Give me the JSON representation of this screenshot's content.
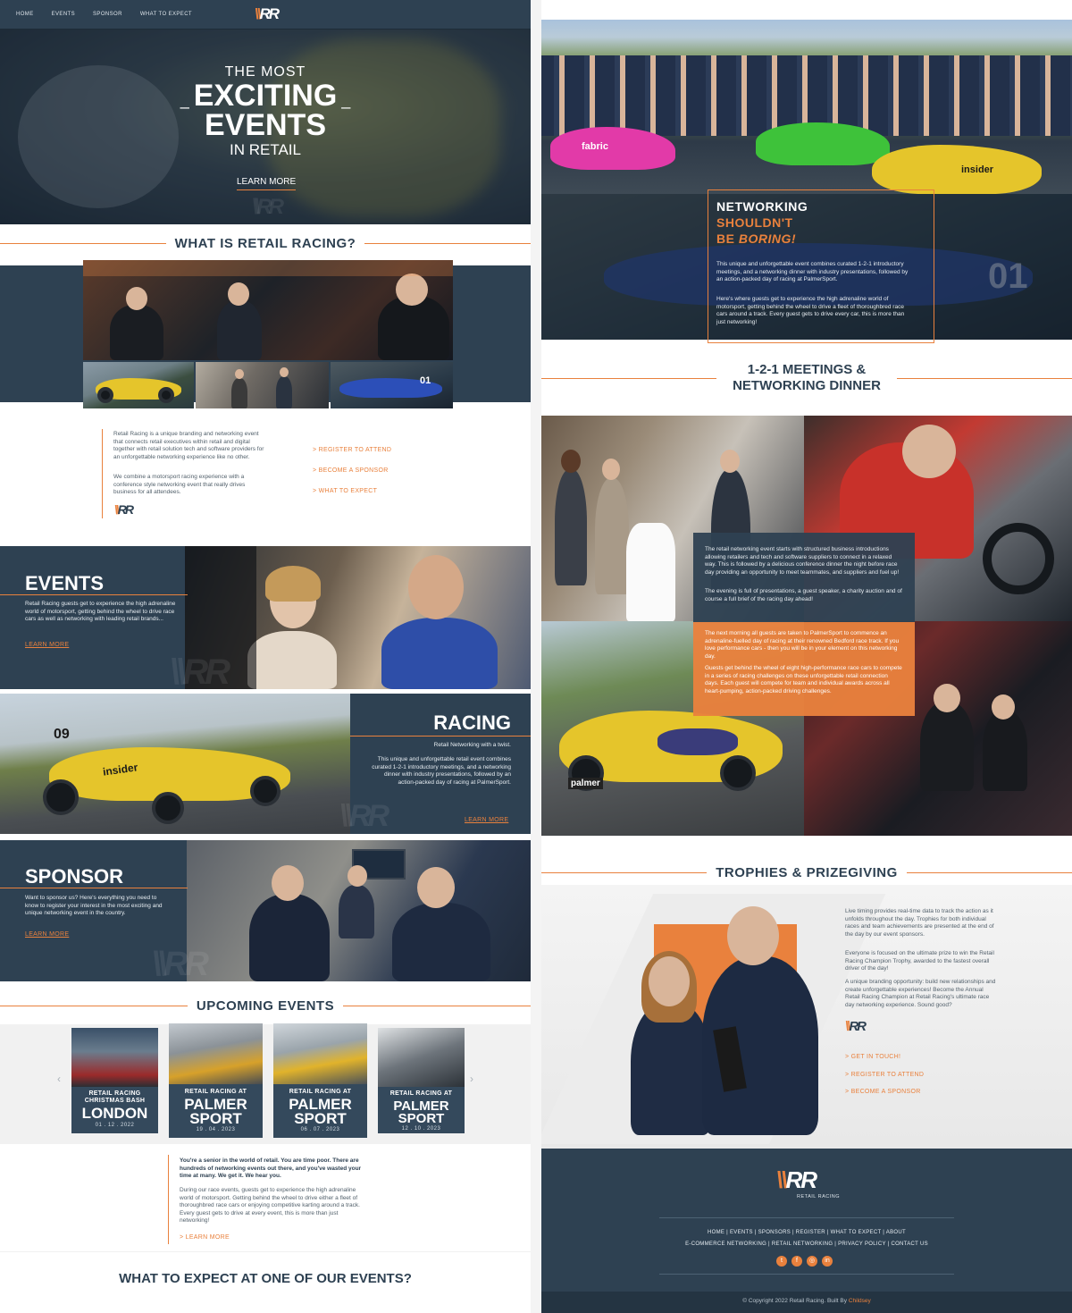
{
  "nav": {
    "items": [
      "HOME",
      "EVENTS",
      "SPONSOR",
      "WHAT TO EXPECT"
    ]
  },
  "hero": {
    "line1": "THE MOST",
    "line2": "EXCITING",
    "line3": "EVENTS",
    "line4": "IN RETAIL",
    "cta": "LEARN MORE"
  },
  "what_is": {
    "heading": "WHAT IS RETAIL RACING?",
    "para1": "Retail Racing is a unique branding and networking event that connects retail executives within retail and digital together with retail solution tech and software providers for an unforgettable networking experience like no other.",
    "para2": "We combine a motorsport racing experience with a conference style networking event that really drives business for all attendees.",
    "links": [
      "> REGISTER TO ATTEND",
      "> BECOME A SPONSOR",
      "> WHAT TO EXPECT"
    ]
  },
  "events": {
    "title": "EVENTS",
    "text": "Retail Racing guests get to experience the high adrenaline world of motorsport, getting behind the wheel to drive race cars as well as networking with leading retail brands...",
    "cta": "LEARN MORE"
  },
  "racing": {
    "title": "RACING",
    "subtitle": "Retail Networking with a twist.",
    "text": "This unique and unforgettable retail event combines curated 1-2-1 introductory meetings, and a networking dinner with industry presentations, followed by an action-packed day of racing at PalmerSport.",
    "cta": "LEARN MORE"
  },
  "sponsor": {
    "title": "SPONSOR",
    "text": "Want to sponsor us? Here's everything you need to know to register your interest in the most exciting and unique networking event in the country.",
    "cta": "LEARN MORE"
  },
  "upcoming": {
    "heading": "UPCOMING EVENTS",
    "cards": [
      {
        "top": "RETAIL RACING",
        "top2": "CHRISTMAS BASH",
        "city": "LONDON",
        "date": "01 . 12 . 2022"
      },
      {
        "top": "RETAIL RACING AT",
        "city": "PALMER",
        "city2": "SPORT",
        "date": "19 . 04 . 2023"
      },
      {
        "top": "RETAIL RACING AT",
        "city": "PALMER",
        "city2": "SPORT",
        "date": "06 . 07 . 2023"
      },
      {
        "top": "RETAIL RACING AT",
        "city": "PALMER",
        "city2": "SPORT",
        "date": "12 . 10 . 2023"
      }
    ],
    "intro": "You're a senior in the world of retail. You are time poor. There are hundreds of networking events out there, and you've wasted your time at many. We get it. We hear you.",
    "body": "During our race events, guests get to experience the high adrenaline world of motorsport. Getting behind the wheel to drive either a fleet of thoroughbred race cars or enjoying competitive karting around a track. Every guest gets to drive at every event, this is more than just networking!",
    "cta": "> LEARN MORE"
  },
  "expect": {
    "heading": "WHAT TO EXPECT AT ONE OF OUR EVENTS?"
  },
  "networking": {
    "l1": "NETWORKING",
    "l2": "SHOULDN'T",
    "l3a": "BE ",
    "l3b": "BORING!",
    "p1": "This unique and unforgettable event combines curated 1-2-1 introductory meetings, and a networking dinner with industry presentations, followed by an action-packed day of racing at PalmerSport.",
    "p2": "Here's where guests get to experience the high adrenaline world of motorsport, getting behind the wheel to drive a fleet of thoroughbred race cars around a track. Every guest gets to drive every car, this is more than just networking!"
  },
  "meetings": {
    "heading1": "1-2-1 MEETINGS &",
    "heading2": "NETWORKING DINNER",
    "box1_p1": "The retail networking event starts with structured business introductions allowing retailers and tech and software suppliers to connect in a relaxed way. This is followed by a delicious conference dinner the night before race day providing an opportunity to meet teammates, and suppliers and fuel up!",
    "box1_p2": "The evening is full of presentations, a guest speaker, a charity auction and of course a full brief of the racing day ahead!",
    "box2_p1": "The next morning all guests are taken to PalmerSport to commence an adrenaline-fuelled day of racing at their renowned Bedford race track. If you love performance cars - then you will be in your element on this networking day.",
    "box2_p2": "Guests get behind the wheel of eight high-performance race cars to compete in a series of racing challenges on these unforgettable retail connection days. Each guest will compete for team and individual awards across all heart-pumping, action-packed driving challenges."
  },
  "trophies": {
    "heading": "TROPHIES & PRIZEGIVING",
    "p1": "Live timing provides real-time data to track the action as it unfolds throughout the day. Trophies for both individual races and team achievements are presented at the end of the day by our event sponsors.",
    "p2": "Everyone is focused on the ultimate prize to win the Retail Racing Champion Trophy, awarded to the fastest overall driver of the day!",
    "p3": "A unique branding opportunity: build new relationships and create unforgettable experiences! Become the Annual Retail Racing Champion at Retail Racing's ultimate race day networking experience. Sound good?",
    "links": [
      "> GET IN TOUCH!",
      "> REGISTER TO ATTEND",
      "> BECOME A SPONSOR"
    ]
  },
  "footer": {
    "brand": "RETAIL RACING",
    "row1": "HOME  |  EVENTS  |  SPONSORS  |  REGISTER  |  WHAT TO EXPECT  |  ABOUT",
    "row2": "E-COMMERCE NETWORKING  |  RETAIL NETWORKING  |  PRIVACY POLICY  |  CONTACT US",
    "social": [
      "twitter-icon",
      "facebook-icon",
      "instagram-icon",
      "linkedin-icon"
    ],
    "copyright": "© Copyright 2022 Retail Racing. Built By ",
    "builder": "Childsey"
  },
  "colors": {
    "navy": "#2e4152",
    "orange": "#e9813d"
  }
}
